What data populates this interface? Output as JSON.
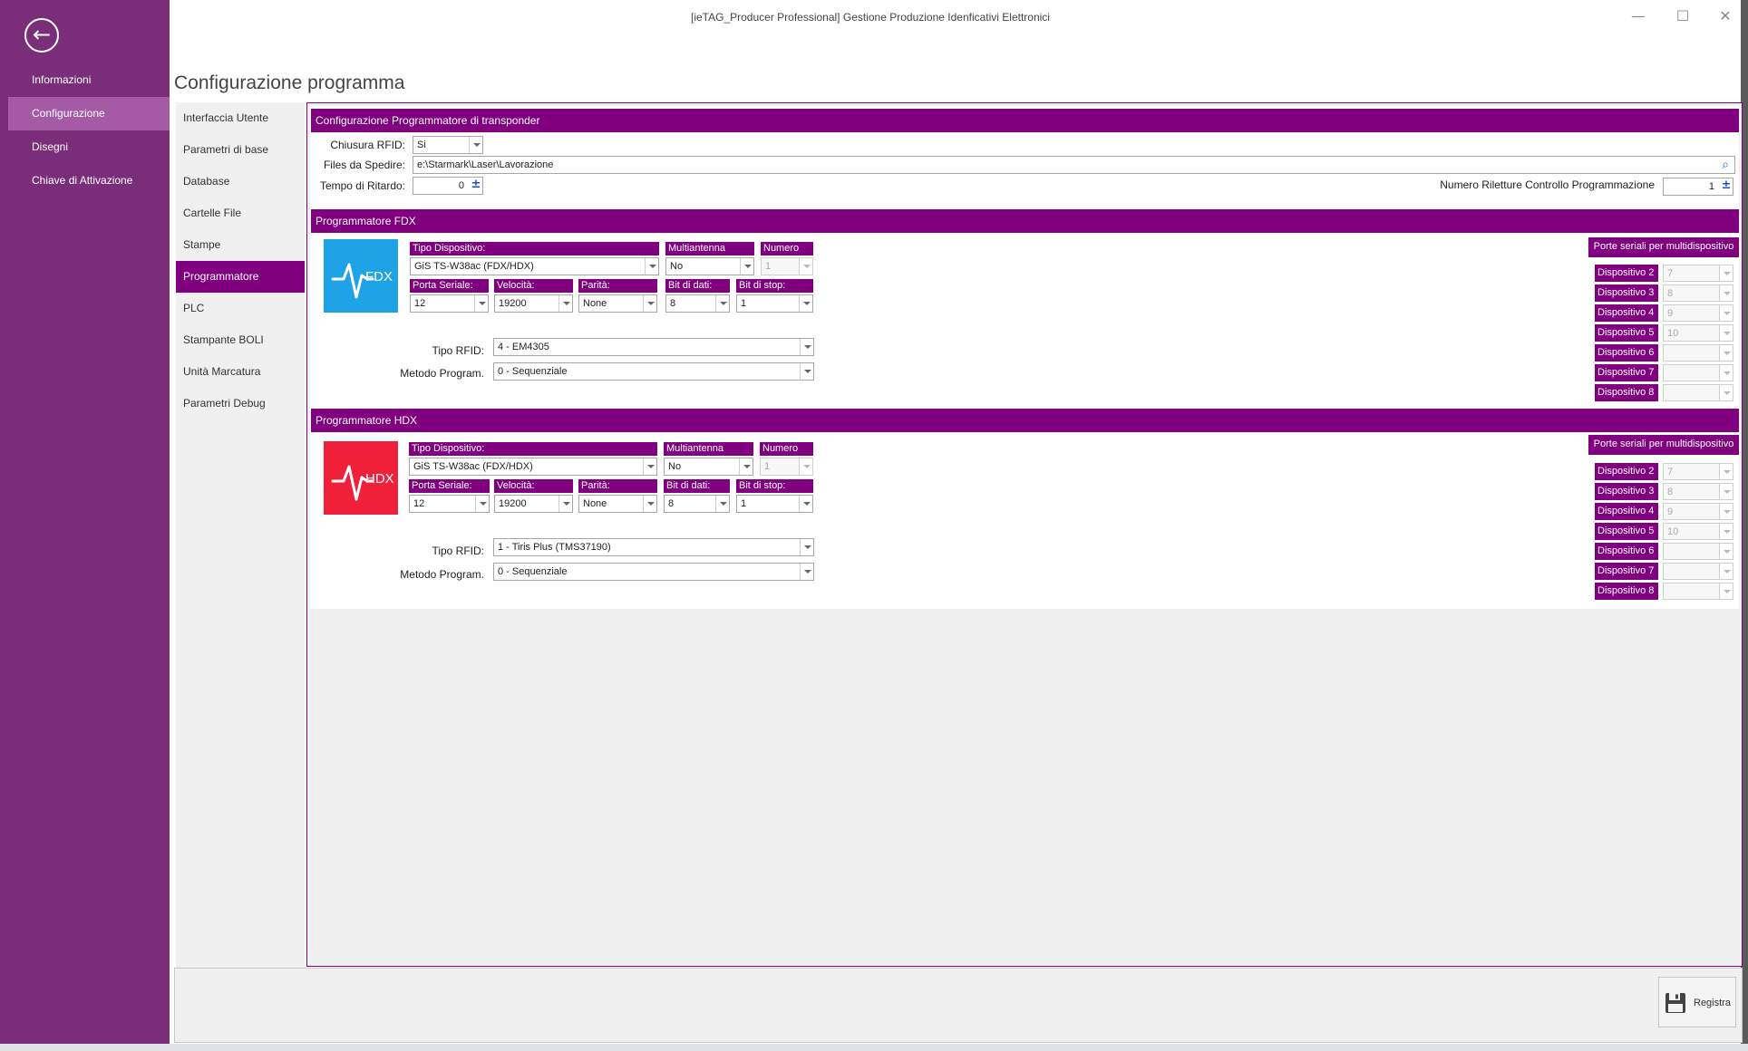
{
  "window": {
    "title": "[ieTAG_Producer Professional] Gestione Produzione Idenficativi Elettronici",
    "controls": {
      "minimize": "—",
      "maximize": "☐",
      "close": "✕"
    }
  },
  "backstage": {
    "back_icon": "arrow-left-icon",
    "items": [
      {
        "label": "Informazioni",
        "active": false
      },
      {
        "label": "Configurazione",
        "active": true
      },
      {
        "label": "Disegni",
        "active": false
      },
      {
        "label": "Chiave di Attivazione",
        "active": false
      }
    ]
  },
  "page_title": "Configurazione programma",
  "tabs": [
    {
      "label": "Interfaccia Utente"
    },
    {
      "label": "Parametri di base"
    },
    {
      "label": "Database"
    },
    {
      "label": "Cartelle File"
    },
    {
      "label": "Stampe"
    },
    {
      "label": "Programmatore",
      "active": true
    },
    {
      "label": "PLC"
    },
    {
      "label": "Stampante BOLI"
    },
    {
      "label": "Unità Marcatura"
    },
    {
      "label": "Parametri Debug"
    }
  ],
  "config": {
    "section_title": "Configurazione Programmatore di transponder",
    "chiusura_label": "Chiusura RFID:",
    "chiusura_value": "Si",
    "files_label": "Files da Spedire:",
    "files_value": "e:\\Starmark\\Laser\\Lavorazione",
    "ritardo_label": "Tempo di Ritardo:",
    "ritardo_value": "0",
    "riletture_label": "Numero Riletture Controllo Programmazione",
    "riletture_value": "1",
    "spin_glyph": "±",
    "search_glyph": "⌕"
  },
  "headers": {
    "tipo_dispositivo": "Tipo Dispositivo:",
    "multiantenna": "Multiantenna",
    "numero": "Numero",
    "porta_seriale": "Porta Seriale:",
    "velocita": "Velocità:",
    "parita": "Parità:",
    "bit_dati": "Bit di dati:",
    "bit_stop": "Bit di stop:",
    "tipo_rfid": "Tipo RFID:",
    "metodo": "Metodo Program.",
    "porte_seriali": "Porte seriali per multidispositivo"
  },
  "fdx": {
    "section_title": "Programmatore FDX",
    "logo_text": "FDX",
    "logo_color": "#1ea3e6",
    "tipo_dispositivo": "GiS TS-W38ac (FDX/HDX)",
    "multiantenna": "No",
    "numero": "1",
    "porta_seriale": "12",
    "velocita": "19200",
    "parita": "None",
    "bit_dati": "8",
    "bit_stop": "1",
    "tipo_rfid": "4 - EM4305",
    "metodo": "0 - Sequenziale",
    "devices": [
      {
        "label": "Dispositivo 2",
        "value": "7"
      },
      {
        "label": "Dispositivo 3",
        "value": "8"
      },
      {
        "label": "Dispositivo 4",
        "value": "9"
      },
      {
        "label": "Dispositivo 5",
        "value": "10"
      },
      {
        "label": "Dispositivo 6",
        "value": ""
      },
      {
        "label": "Dispositivo 7",
        "value": ""
      },
      {
        "label": "Dispositivo 8",
        "value": ""
      }
    ]
  },
  "hdx": {
    "section_title": "Programmatore HDX",
    "logo_text": "HDX",
    "logo_color": "#f0203a",
    "tipo_dispositivo": "GiS TS-W38ac (FDX/HDX)",
    "multiantenna": "No",
    "numero": "1",
    "porta_seriale": "12",
    "velocita": "19200",
    "parita": "None",
    "bit_dati": "8",
    "bit_stop": "1",
    "tipo_rfid": "1 - Tiris Plus (TMS37190)",
    "metodo": "0 - Sequenziale",
    "devices": [
      {
        "label": "Dispositivo 2",
        "value": "7"
      },
      {
        "label": "Dispositivo 3",
        "value": "8"
      },
      {
        "label": "Dispositivo 4",
        "value": "9"
      },
      {
        "label": "Dispositivo 5",
        "value": "10"
      },
      {
        "label": "Dispositivo 6",
        "value": ""
      },
      {
        "label": "Dispositivo 7",
        "value": ""
      },
      {
        "label": "Dispositivo 8",
        "value": ""
      }
    ]
  },
  "footer": {
    "save_label": "Registra",
    "save_icon": "floppy-disk-icon"
  },
  "colors": {
    "accent": "#800080",
    "backstage": "#7a2e7a",
    "backstage_active": "#a55aa5"
  }
}
